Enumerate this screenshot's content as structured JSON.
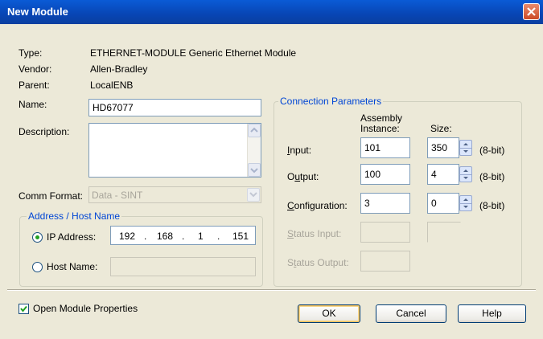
{
  "window": {
    "title": "New Module"
  },
  "info": [
    {
      "label": "Type:",
      "value": "ETHERNET-MODULE Generic Ethernet Module"
    },
    {
      "label": "Vendor:",
      "value": "Allen-Bradley"
    },
    {
      "label": "Parent:",
      "value": "LocalENB"
    }
  ],
  "name": {
    "label": "Name:",
    "value": "HD67077"
  },
  "description": {
    "label": "Description:",
    "value": ""
  },
  "comm_format": {
    "label": "Comm Format:",
    "value": "Data - SINT"
  },
  "address": {
    "group_label": "Address / Host Name",
    "ip_label": "IP Address:",
    "ip": {
      "o1": "192",
      "o2": "168",
      "o3": "1",
      "o4": "151",
      "sep": "."
    },
    "host_label": "Host Name:",
    "host_value": ""
  },
  "connection": {
    "group_label": "Connection Parameters",
    "col_assembly": "Assembly",
    "col_instance": "Instance:",
    "col_size": "Size:",
    "unit": "(8-bit)",
    "rows": [
      {
        "label_pre": "",
        "label_key": "I",
        "label_post": "nput:",
        "instance": "101",
        "size": "350"
      },
      {
        "label_pre": "O",
        "label_key": "u",
        "label_post": "tput:",
        "instance": "100",
        "size": "4"
      },
      {
        "label_pre": "",
        "label_key": "C",
        "label_post": "onfiguration:",
        "instance": "3",
        "size": "0"
      }
    ],
    "status_input": {
      "label_key": "S",
      "label_post": "tatus Input:"
    },
    "status_output": {
      "label_pre": "S",
      "label_key": "t",
      "label_post": "atus Output:"
    }
  },
  "open_props": {
    "label": "Open Module Properties",
    "checked": true
  },
  "buttons": {
    "ok": "OK",
    "cancel": "Cancel",
    "help": "Help"
  },
  "icons": [
    "close-icon",
    "spin-up-icon",
    "spin-down-icon",
    "scroll-up-icon",
    "scroll-down-icon",
    "dropdown-arrow-icon",
    "checkmark-icon"
  ],
  "colors": {
    "titlebar": "#0845b4",
    "dialog": "#ece9d8",
    "group_label": "#0046d5",
    "close": "#cc4a26"
  }
}
